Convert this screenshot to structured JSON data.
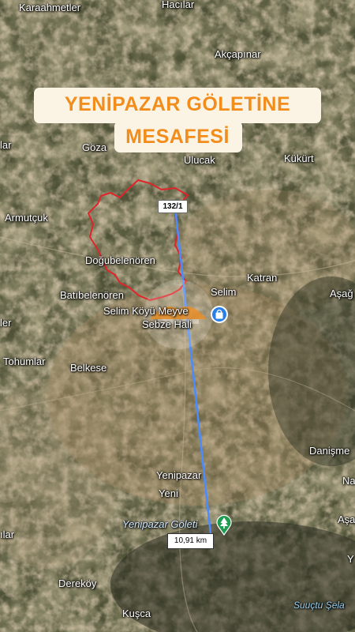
{
  "title": {
    "line1": "YENİPAZAR GÖLETİNE",
    "line2": "MESAFESİ"
  },
  "road_label": "132/1",
  "distance_label": "10,91 km",
  "colors": {
    "title_text": "#f28c1b",
    "title_bg": "#fbf4e4",
    "measure_line": "#4a8cff",
    "boundary": "#e0242a",
    "poi_blue": "#2a7fe6",
    "poi_green": "#1e9c4f"
  },
  "places": [
    {
      "name": "Karaahmetler",
      "style": "normal"
    },
    {
      "name": "Hacılar",
      "style": "normal"
    },
    {
      "name": "Akçapınar",
      "style": "normal"
    },
    {
      "name": "lar",
      "style": "normal"
    },
    {
      "name": "Göza",
      "style": "normal"
    },
    {
      "name": "Ulucak",
      "style": "normal"
    },
    {
      "name": "Kükürt",
      "style": "normal"
    },
    {
      "name": "Armutçuk",
      "style": "normal"
    },
    {
      "name": "Doğubelenören",
      "style": "normal"
    },
    {
      "name": "Batıbelenören",
      "style": "normal"
    },
    {
      "name": "Selim",
      "style": "normal"
    },
    {
      "name": "Katran",
      "style": "normal"
    },
    {
      "name": "Aşağ",
      "style": "normal"
    },
    {
      "name": "ler",
      "style": "normal"
    },
    {
      "name": "Selim Köyü Meyve",
      "style": "normal"
    },
    {
      "name": "Sebze Hali",
      "style": "normal"
    },
    {
      "name": "Tohumlar",
      "style": "normal"
    },
    {
      "name": "Belkese",
      "style": "normal"
    },
    {
      "name": "Danişme",
      "style": "normal"
    },
    {
      "name": "Yenipazar",
      "style": "normal"
    },
    {
      "name": "Na",
      "style": "normal"
    },
    {
      "name": "Yeni",
      "style": "normal"
    },
    {
      "name": "Yenipazar Göleti",
      "style": "italic"
    },
    {
      "name": "Aşa",
      "style": "normal"
    },
    {
      "name": "ılar",
      "style": "normal"
    },
    {
      "name": "Y",
      "style": "normal"
    },
    {
      "name": "Dereköy",
      "style": "normal"
    },
    {
      "name": "Kuşca",
      "style": "normal"
    },
    {
      "name": "Suuçtu Şela",
      "style": "aqua"
    }
  ],
  "icons": {
    "market": "shopping-bag-icon",
    "park": "tree-icon",
    "watermark": "logo-watermark"
  }
}
